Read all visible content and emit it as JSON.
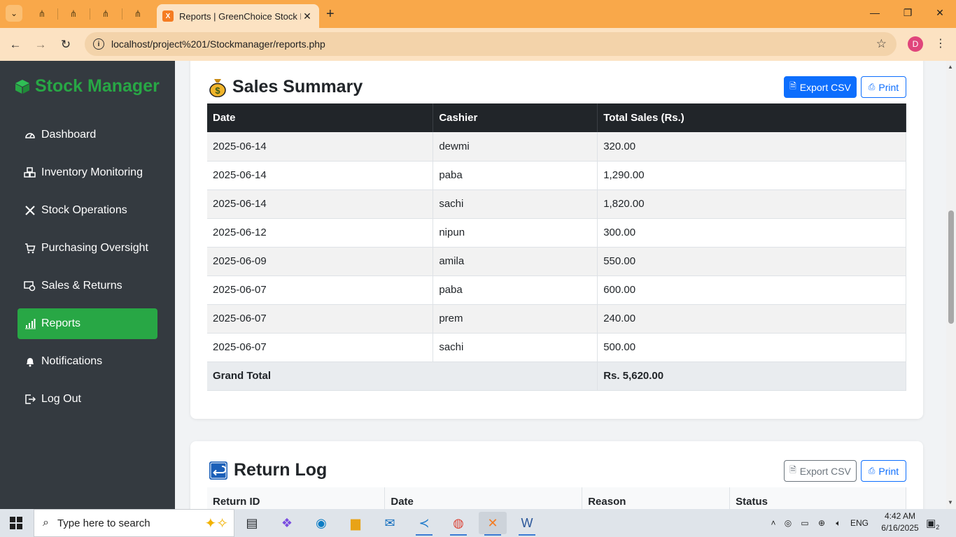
{
  "browser": {
    "tab_title": "Reports | GreenChoice Stock Ma",
    "url": "localhost/project%201/Stockmanager/reports.php",
    "profile_initial": "D"
  },
  "sidebar": {
    "brand": "Stock Manager",
    "items": [
      {
        "label": "Dashboard",
        "icon": "dashboard-icon"
      },
      {
        "label": "Inventory Monitoring",
        "icon": "boxes-icon"
      },
      {
        "label": "Stock Operations",
        "icon": "tools-icon"
      },
      {
        "label": "Purchasing Oversight",
        "icon": "cart-icon"
      },
      {
        "label": "Sales & Returns",
        "icon": "cash-icon"
      },
      {
        "label": "Reports",
        "icon": "bar-chart-icon",
        "active": true
      },
      {
        "label": "Notifications",
        "icon": "bell-icon"
      },
      {
        "label": "Log Out",
        "icon": "logout-icon"
      }
    ]
  },
  "sales_summary": {
    "title": "Sales Summary",
    "export_label": "Export CSV",
    "print_label": "Print",
    "columns": [
      "Date",
      "Cashier",
      "Total Sales (Rs.)"
    ],
    "rows": [
      [
        "2025-06-14",
        "dewmi",
        "320.00"
      ],
      [
        "2025-06-14",
        "paba",
        "1,290.00"
      ],
      [
        "2025-06-14",
        "sachi",
        "1,820.00"
      ],
      [
        "2025-06-12",
        "nipun",
        "300.00"
      ],
      [
        "2025-06-09",
        "amila",
        "550.00"
      ],
      [
        "2025-06-07",
        "paba",
        "600.00"
      ],
      [
        "2025-06-07",
        "prem",
        "240.00"
      ],
      [
        "2025-06-07",
        "sachi",
        "500.00"
      ]
    ],
    "footer_label": "Grand Total",
    "footer_value": "Rs. 5,620.00"
  },
  "return_log": {
    "title": "Return Log",
    "export_label": "Export CSV",
    "print_label": "Print",
    "columns": [
      "Return ID",
      "Date",
      "Reason",
      "Status"
    ]
  },
  "taskbar": {
    "search_placeholder": "Type here to search",
    "language": "ENG",
    "time": "4:42 AM",
    "date": "6/16/2025",
    "notification_count": "2"
  },
  "colors": {
    "accent": "#28a745",
    "sidebar_bg": "#343a40",
    "primary": "#0d6efd",
    "browser_frame": "#f9a84a"
  }
}
